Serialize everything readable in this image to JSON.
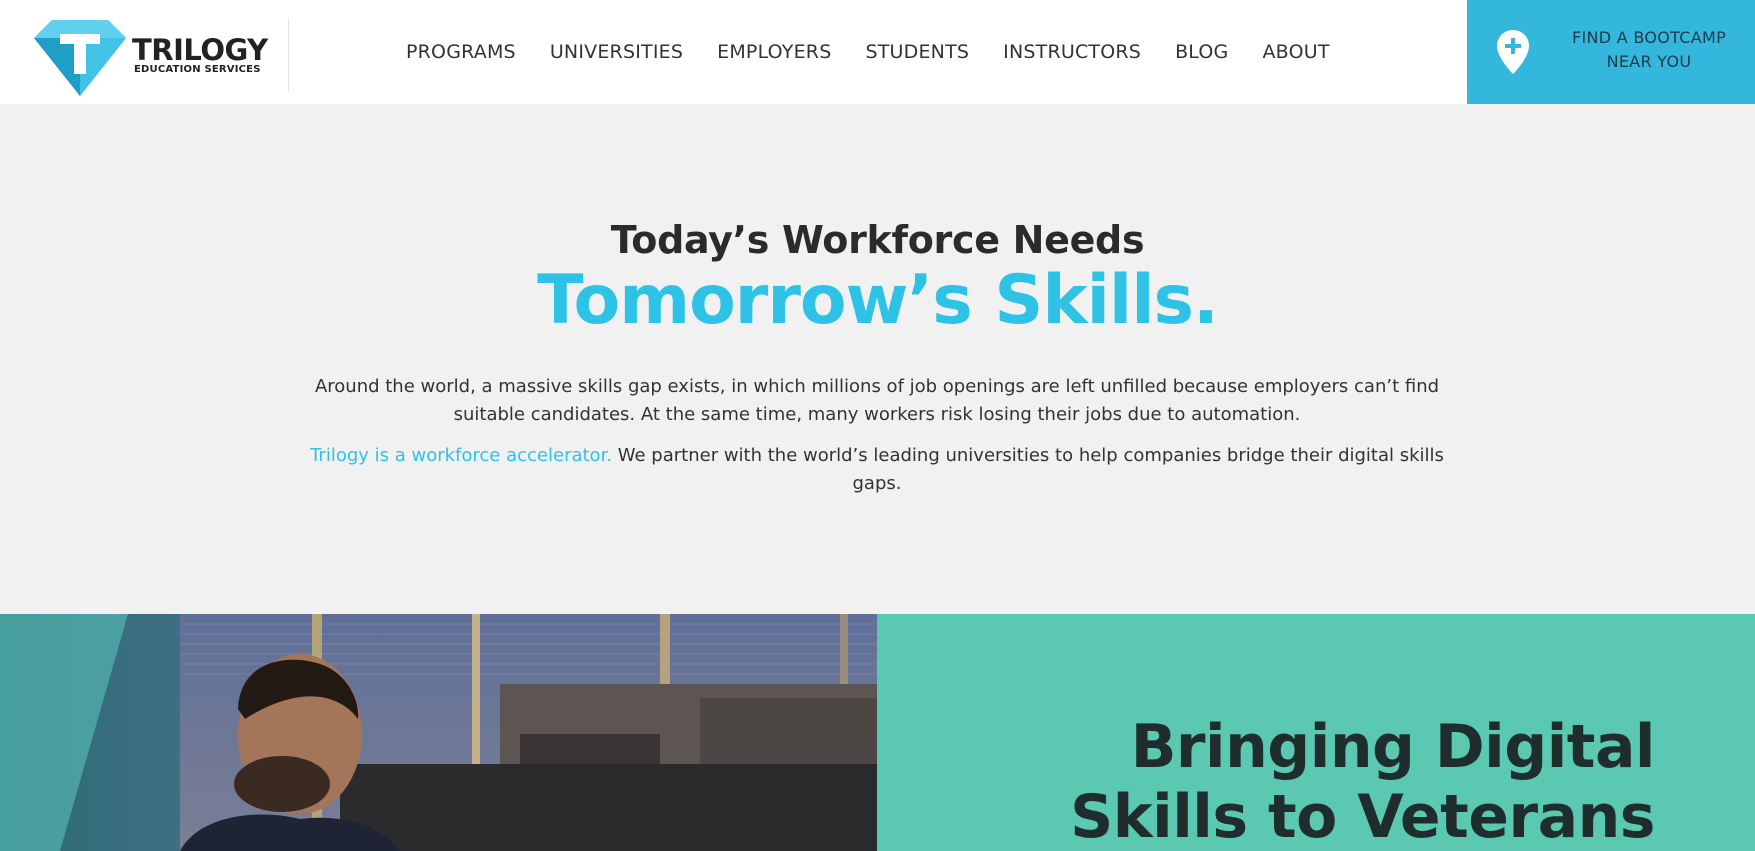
{
  "brand": {
    "title": "TRILOGY",
    "subtitle": "EDUCATION SERVICES",
    "logo_icon": "diamond-t-logo-icon",
    "color": "#33b7dc"
  },
  "nav": {
    "items": [
      {
        "label": "PROGRAMS"
      },
      {
        "label": "UNIVERSITIES"
      },
      {
        "label": "EMPLOYERS"
      },
      {
        "label": "STUDENTS"
      },
      {
        "label": "INSTRUCTORS"
      },
      {
        "label": "BLOG"
      },
      {
        "label": "ABOUT"
      }
    ]
  },
  "cta": {
    "line1": "FIND A BOOTCAMP",
    "line2": "NEAR YOU",
    "icon": "map-pin-plus-icon",
    "color": "#33b7dc"
  },
  "hero": {
    "title": "Today’s Workforce Needs",
    "accent": "Tomorrow’s Skills.",
    "accent_color": "#2ec3e6",
    "paragraph1": "Around the world, a massive skills gap exists, in which millions of job openings are left unfilled because employers can’t find suitable candidates. At the same time, many workers risk losing their jobs due to automation.",
    "paragraph2_link": "Trilogy is a workforce accelerator.",
    "paragraph2_rest": " We partner with the world’s leading universities to help companies bridge their digital skills gaps."
  },
  "feature": {
    "heading_line1": "Bringing Digital",
    "heading_line2": "Skills to Veterans",
    "panel_color": "#5bc8b2"
  }
}
